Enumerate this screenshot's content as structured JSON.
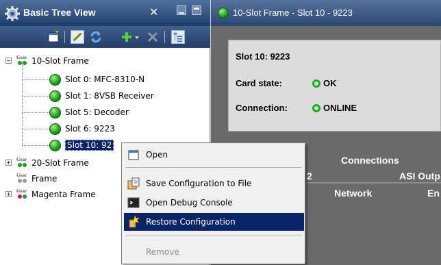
{
  "left_panel": {
    "title": "Basic Tree View",
    "icons": [
      "gear-icon",
      "close-icon",
      "minimize-icon",
      "maximize-icon"
    ],
    "toolbar_icons": [
      "new-icon",
      "edit-icon",
      "refresh-icon",
      "add-icon",
      "dropdown-icon",
      "delete-icon",
      "tree-view-icon"
    ]
  },
  "tree": {
    "gear_badge": "Gear",
    "root1": {
      "label": "10-Slot Frame",
      "expander": "−"
    },
    "slots": [
      {
        "label": "Slot 0: MFC-8310-N"
      },
      {
        "label": "Slot 1: 8VSB Receiver"
      },
      {
        "label": "Slot 5: Decoder"
      },
      {
        "label": "Slot 6: 9223"
      }
    ],
    "selected_slot": {
      "label": "Slot 10: 92"
    },
    "root2": {
      "label": "20-Slot Frame",
      "expander": "+"
    },
    "root3": {
      "label": "Frame"
    },
    "root4": {
      "label": "Magenta Frame",
      "expander": "+"
    }
  },
  "right_panel": {
    "title": "10-Slot Frame - Slot 10 - 9223",
    "slot_heading": "Slot 10: 9223",
    "card_state_label": "Card state:",
    "card_state_value": "OK",
    "connection_label": "Connection:",
    "connection_value": "ONLINE",
    "tabs": {
      "connections": "Connections",
      "tab_2": "2",
      "asi_output": "ASI Outp",
      "network": "Network",
      "en": "En"
    },
    "colors": {
      "status_green": "#13b413",
      "title_bar": "#2a4774"
    }
  },
  "context_menu": {
    "items": [
      {
        "label": "Open",
        "icon": "open-icon"
      },
      {
        "label": "Save Configuration to File",
        "icon": "save-config-icon"
      },
      {
        "label": "Open Debug Console",
        "icon": "console-icon"
      },
      {
        "label": "Restore Configuration",
        "icon": "restore-icon",
        "highlighted": true
      },
      {
        "label": "Remove",
        "icon": "",
        "disabled": true
      }
    ]
  }
}
